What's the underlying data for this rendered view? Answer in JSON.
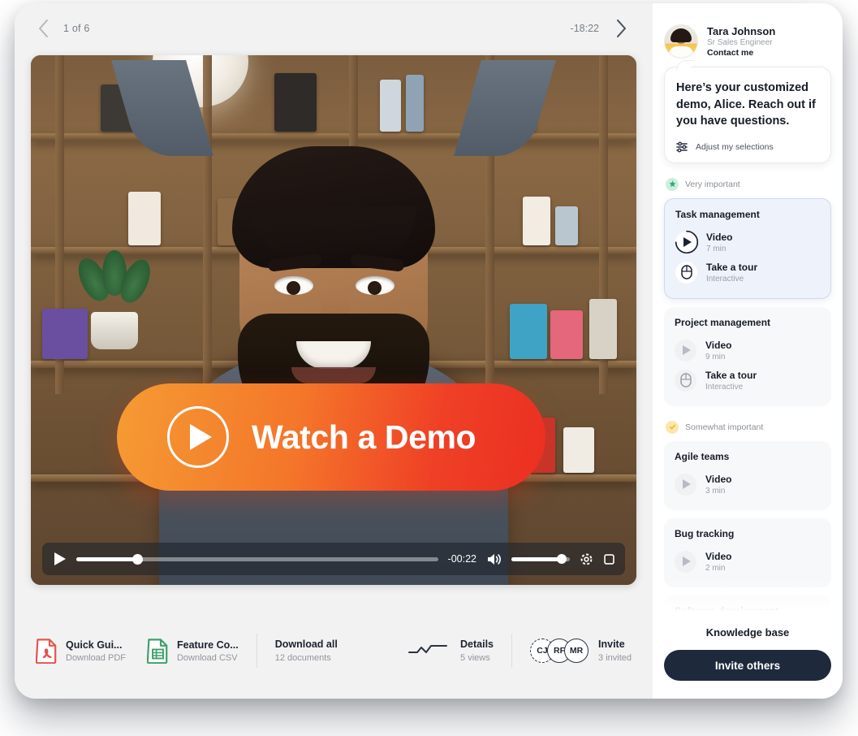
{
  "topbar": {
    "prev_icon": "chevron-left-icon",
    "page_count": "1 of 6",
    "remaining_time": "-18:22",
    "next_icon": "chevron-right-icon"
  },
  "video": {
    "cta_label": "Watch a Demo",
    "cta_icon": "play-circle-icon",
    "cta_gradient_from": "#f59b33",
    "cta_gradient_to": "#eb2f22",
    "controls": {
      "play_icon": "play-icon",
      "time": "-00:22",
      "volume_icon": "volume-icon",
      "settings_icon": "gear-icon",
      "fullscreen_icon": "fullscreen-icon",
      "progress_percent": 17,
      "volume_percent": 86
    }
  },
  "bottombar": {
    "documents": [
      {
        "title": "Quick Gui...",
        "subtitle": "Download PDF",
        "icon": "pdf-file-icon",
        "color": "#e2554d"
      },
      {
        "title": "Feature Co...",
        "subtitle": "Download CSV",
        "icon": "csv-file-icon",
        "color": "#3fa06a"
      }
    ],
    "download_all": {
      "title": "Download all",
      "subtitle": "12 documents"
    },
    "details": {
      "title": "Details",
      "subtitle": "5 views",
      "icon": "sparkline-icon"
    },
    "invite": {
      "title": "Invite",
      "subtitle": "3 invited"
    },
    "avatars": [
      {
        "initials": "CJ",
        "dashed": true
      },
      {
        "initials": "RF",
        "dashed": false
      },
      {
        "initials": "MR",
        "dashed": false
      }
    ]
  },
  "sidebar": {
    "presenter": {
      "name": "Tara Johnson",
      "role": "Sr Sales Engineer",
      "contact_label": "Contact me"
    },
    "bubble": {
      "message": "Here’s your customized demo, Alice. Reach out if you have questions.",
      "adjust_label": "Adjust my selections",
      "adjust_icon": "sliders-icon"
    },
    "sections": [
      {
        "label": "Very important",
        "badge_icon": "star-icon",
        "badge_color": "#2fa96f",
        "cards": [
          {
            "title": "Task management",
            "active": true,
            "items": [
              {
                "title": "Video",
                "subtitle": "7 min",
                "icon": "play-icon"
              },
              {
                "title": "Take a tour",
                "subtitle": "Interactive",
                "icon": "mouse-icon"
              }
            ]
          },
          {
            "title": "Project management",
            "active": false,
            "items": [
              {
                "title": "Video",
                "subtitle": "9 min",
                "icon": "play-icon"
              },
              {
                "title": "Take a tour",
                "subtitle": "Interactive",
                "icon": "mouse-icon"
              }
            ]
          }
        ]
      },
      {
        "label": "Somewhat important",
        "badge_icon": "check-icon",
        "badge_color": "#e3b93c",
        "cards": [
          {
            "title": "Agile teams",
            "active": false,
            "items": [
              {
                "title": "Video",
                "subtitle": "3 min",
                "icon": "play-icon"
              }
            ]
          },
          {
            "title": "Bug tracking",
            "active": false,
            "items": [
              {
                "title": "Video",
                "subtitle": "2 min",
                "icon": "play-icon"
              }
            ]
          },
          {
            "title": "Software development",
            "active": false,
            "items": []
          }
        ]
      }
    ],
    "footer": {
      "knowledge_base_label": "Knowledge base",
      "invite_button_label": "Invite others"
    }
  }
}
